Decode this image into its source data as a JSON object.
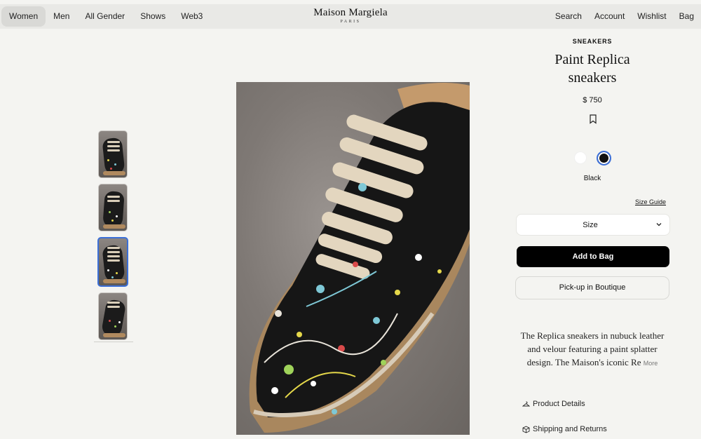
{
  "header": {
    "nav_left": [
      "Women",
      "Men",
      "All Gender",
      "Shows",
      "Web3"
    ],
    "active": "Women",
    "logo_name": "Maison Margiela",
    "logo_city": "PARIS",
    "nav_right": [
      "Search",
      "Account",
      "Wishlist",
      "Bag"
    ]
  },
  "product": {
    "category": "SNEAKERS",
    "title_line1": "Paint Replica",
    "title_line2": "sneakers",
    "price": "$ 750",
    "color_name": "Black",
    "size_guide": "Size Guide",
    "size_label": "Size",
    "add_to_bag": "Add to Bag",
    "pickup": "Pick-up in Boutique",
    "description": "The Replica sneakers in nubuck leather and velour featuring a paint splatter design. The Maison's iconic Re",
    "more": "More",
    "product_details": "Product Details",
    "shipping_returns": "Shipping and Returns"
  },
  "colors": {
    "accent_blue": "#3b6fd8",
    "button_black": "#000000",
    "background": "#f4f4f1"
  },
  "swatches": [
    "white",
    "black"
  ],
  "selected_swatch": "black",
  "thumbnails": {
    "count": 4,
    "selected_index": 2
  }
}
